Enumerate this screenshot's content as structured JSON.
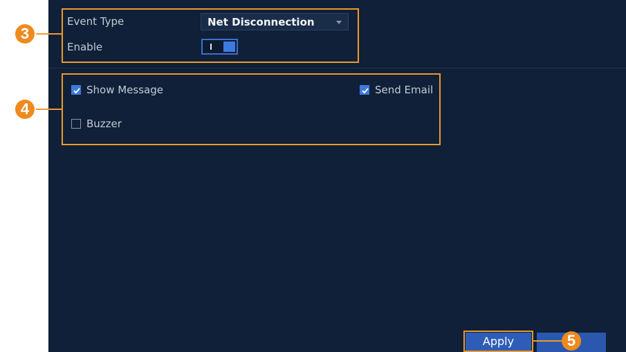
{
  "event": {
    "event_type_label": "Event Type",
    "event_type_value": "Net Disconnection",
    "enable_label": "Enable",
    "enable_on": true
  },
  "actions": {
    "show_message": {
      "label": "Show Message",
      "checked": true
    },
    "send_email": {
      "label": "Send Email",
      "checked": true
    },
    "buzzer": {
      "label": "Buzzer",
      "checked": false
    }
  },
  "buttons": {
    "apply_label": "Apply"
  },
  "callouts": {
    "c3": "3",
    "c4": "4",
    "c5": "5"
  },
  "colors": {
    "panel_bg": "#0f2038",
    "accent_blue": "#3f79de",
    "callout_orange": "#ef9a2c"
  }
}
